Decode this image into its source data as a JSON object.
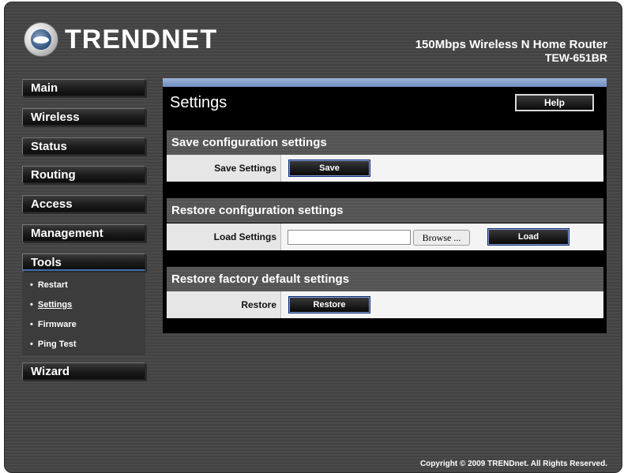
{
  "header": {
    "brand": "TRENDNET",
    "product_name": "150Mbps Wireless N Home Router",
    "model": "TEW-651BR"
  },
  "nav": {
    "main": "Main",
    "wireless": "Wireless",
    "status": "Status",
    "routing": "Routing",
    "access": "Access",
    "management": "Management",
    "tools": "Tools",
    "wizard": "Wizard"
  },
  "tools_menu": {
    "bullet": "•",
    "restart": "Restart",
    "settings": "Settings",
    "firmware": "Firmware",
    "ping_test": "Ping Test"
  },
  "panel": {
    "title": "Settings",
    "help_label": "Help"
  },
  "save_section": {
    "heading": "Save configuration settings",
    "label": "Save Settings",
    "button": "Save"
  },
  "restore_section": {
    "heading": "Restore configuration settings",
    "label": "Load Settings",
    "file_value": "",
    "browse": "Browse ...",
    "button": "Load"
  },
  "factory_section": {
    "heading": "Restore factory default settings",
    "label": "Restore",
    "button": "Restore"
  },
  "footer": {
    "copyright": "Copyright © 2009 TRENDnet. All Rights Reserved."
  }
}
